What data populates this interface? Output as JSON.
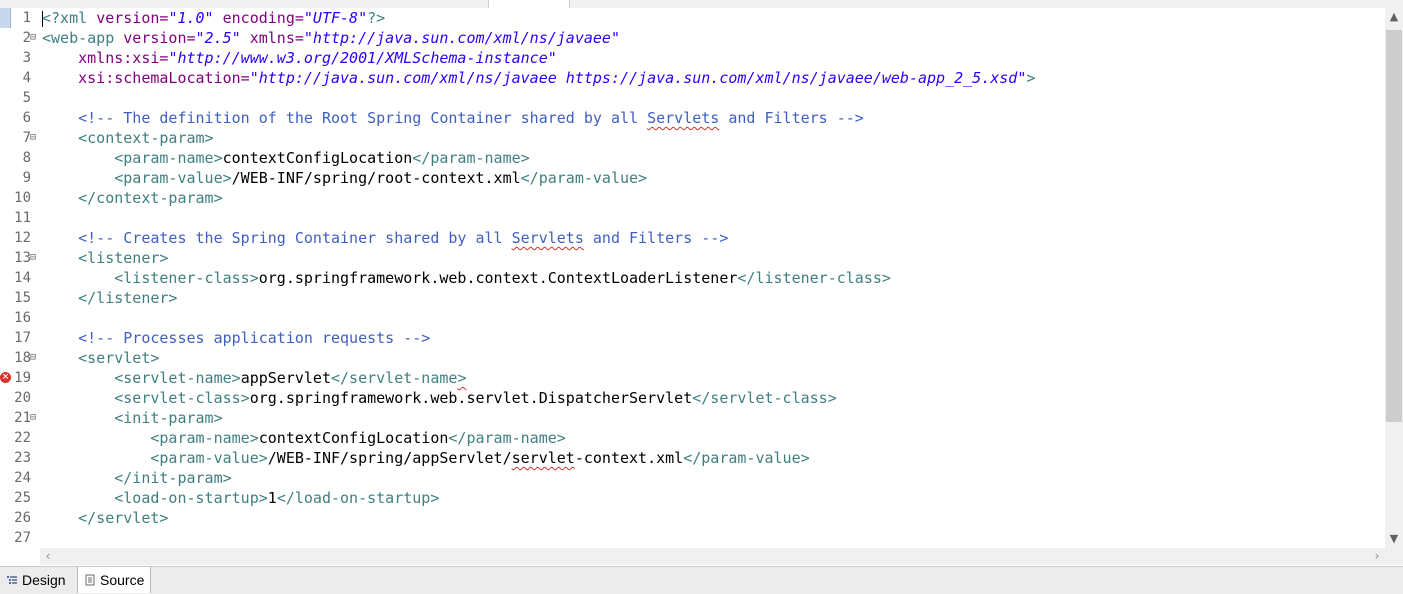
{
  "editor": {
    "lines": [
      {
        "n": "1",
        "tokens": [
          [
            "pi",
            "<?xml "
          ],
          [
            "attr",
            "version="
          ],
          [
            "val",
            "\"1.0\""
          ],
          [
            "txt",
            " "
          ],
          [
            "attr",
            "encoding="
          ],
          [
            "val",
            "\"UTF-8\""
          ],
          [
            "pi",
            "?>"
          ]
        ]
      },
      {
        "n": "2",
        "fold": true,
        "tokens": [
          [
            "tag",
            "<web-app "
          ],
          [
            "attr",
            "version="
          ],
          [
            "val",
            "\"2.5\""
          ],
          [
            "txt",
            " "
          ],
          [
            "attr",
            "xmlns="
          ],
          [
            "val",
            "\"http://java.sun.com/xml/ns/javaee\""
          ]
        ]
      },
      {
        "n": "3",
        "tokens": [
          [
            "txt",
            "    "
          ],
          [
            "attr",
            "xmlns:xsi="
          ],
          [
            "val",
            "\"http://www.w3.org/2001/XMLSchema-instance\""
          ]
        ]
      },
      {
        "n": "4",
        "tokens": [
          [
            "txt",
            "    "
          ],
          [
            "attr",
            "xsi:schemaLocation="
          ],
          [
            "val",
            "\"http://java.sun.com/xml/ns/javaee https://java.sun.com/xml/ns/javaee/web-app_2_5.xsd\""
          ],
          [
            "tag",
            ">"
          ]
        ]
      },
      {
        "n": "5",
        "tokens": []
      },
      {
        "n": "6",
        "tokens": [
          [
            "txt",
            "    "
          ],
          [
            "cmt",
            "<!-- The definition of the Root Spring Container shared by all "
          ],
          [
            "cmt squig",
            "Servlets"
          ],
          [
            "cmt",
            " and Filters -->"
          ]
        ]
      },
      {
        "n": "7",
        "fold": true,
        "tokens": [
          [
            "txt",
            "    "
          ],
          [
            "tag",
            "<context-param>"
          ]
        ]
      },
      {
        "n": "8",
        "tokens": [
          [
            "txt",
            "        "
          ],
          [
            "tag",
            "<param-name>"
          ],
          [
            "txt",
            "contextConfigLocation"
          ],
          [
            "tag",
            "</param-name>"
          ]
        ]
      },
      {
        "n": "9",
        "tokens": [
          [
            "txt",
            "        "
          ],
          [
            "tag",
            "<param-value>"
          ],
          [
            "txt",
            "/WEB-INF/spring/root-context.xml"
          ],
          [
            "tag",
            "</param-value>"
          ]
        ]
      },
      {
        "n": "10",
        "tokens": [
          [
            "txt",
            "    "
          ],
          [
            "tag",
            "</context-param>"
          ]
        ]
      },
      {
        "n": "11",
        "tokens": []
      },
      {
        "n": "12",
        "tokens": [
          [
            "txt",
            "    "
          ],
          [
            "cmt",
            "<!-- Creates the Spring Container shared by all "
          ],
          [
            "cmt squig",
            "Servlets"
          ],
          [
            "cmt",
            " and Filters -->"
          ]
        ]
      },
      {
        "n": "13",
        "fold": true,
        "tokens": [
          [
            "txt",
            "    "
          ],
          [
            "tag",
            "<listener>"
          ]
        ]
      },
      {
        "n": "14",
        "tokens": [
          [
            "txt",
            "        "
          ],
          [
            "tag",
            "<listener-class>"
          ],
          [
            "txt",
            "org.springframework.web.context.ContextLoaderListener"
          ],
          [
            "tag",
            "</listener-class>"
          ]
        ]
      },
      {
        "n": "15",
        "tokens": [
          [
            "txt",
            "    "
          ],
          [
            "tag",
            "</listener>"
          ]
        ]
      },
      {
        "n": "16",
        "tokens": []
      },
      {
        "n": "17",
        "tokens": [
          [
            "txt",
            "    "
          ],
          [
            "cmt",
            "<!-- Processes application requests -->"
          ]
        ]
      },
      {
        "n": "18",
        "fold": true,
        "tokens": [
          [
            "txt",
            "    "
          ],
          [
            "tag",
            "<servlet>"
          ]
        ]
      },
      {
        "n": "19",
        "error": true,
        "tokens": [
          [
            "txt",
            "        "
          ],
          [
            "tag",
            "<servlet-name>"
          ],
          [
            "txt",
            "appServlet"
          ],
          [
            "tag",
            "</servlet-name"
          ],
          [
            "tag squig",
            ">"
          ]
        ]
      },
      {
        "n": "20",
        "tokens": [
          [
            "txt",
            "        "
          ],
          [
            "tag",
            "<servlet-class>"
          ],
          [
            "txt",
            "org.springframework.web.servlet.DispatcherServlet"
          ],
          [
            "tag",
            "</servlet-class>"
          ]
        ]
      },
      {
        "n": "21",
        "fold": true,
        "tokens": [
          [
            "txt",
            "        "
          ],
          [
            "tag",
            "<init-param>"
          ]
        ]
      },
      {
        "n": "22",
        "tokens": [
          [
            "txt",
            "            "
          ],
          [
            "tag",
            "<param-name>"
          ],
          [
            "txt",
            "contextConfigLocation"
          ],
          [
            "tag",
            "</param-name>"
          ]
        ]
      },
      {
        "n": "23",
        "tokens": [
          [
            "txt",
            "            "
          ],
          [
            "tag",
            "<param-value>"
          ],
          [
            "txt",
            "/WEB-INF/spring/appServlet/"
          ],
          [
            "txt squig",
            "servlet"
          ],
          [
            "txt",
            "-context.xml"
          ],
          [
            "tag",
            "</param-value>"
          ]
        ]
      },
      {
        "n": "24",
        "tokens": [
          [
            "txt",
            "        "
          ],
          [
            "tag",
            "</init-param>"
          ]
        ]
      },
      {
        "n": "25",
        "tokens": [
          [
            "txt",
            "        "
          ],
          [
            "tag",
            "<load-on-startup>"
          ],
          [
            "txt",
            "1"
          ],
          [
            "tag",
            "</load-on-startup>"
          ]
        ]
      },
      {
        "n": "26",
        "tokens": [
          [
            "txt",
            "    "
          ],
          [
            "tag",
            "</servlet>"
          ]
        ]
      },
      {
        "n": "27",
        "tokens": []
      }
    ]
  },
  "bottom_tabs": {
    "design_label": "Design",
    "source_label": "Source",
    "active": "Source"
  },
  "icons": {
    "fold": "collapse-minus-icon",
    "error": "error-marker-icon",
    "design": "design-view-icon",
    "source": "source-file-icon"
  },
  "colors": {
    "tag": "#3f7f7f",
    "attribute": "#7f007f",
    "value": "#2a00ff",
    "comment": "#3f5fbf",
    "error": "#d9332b"
  }
}
